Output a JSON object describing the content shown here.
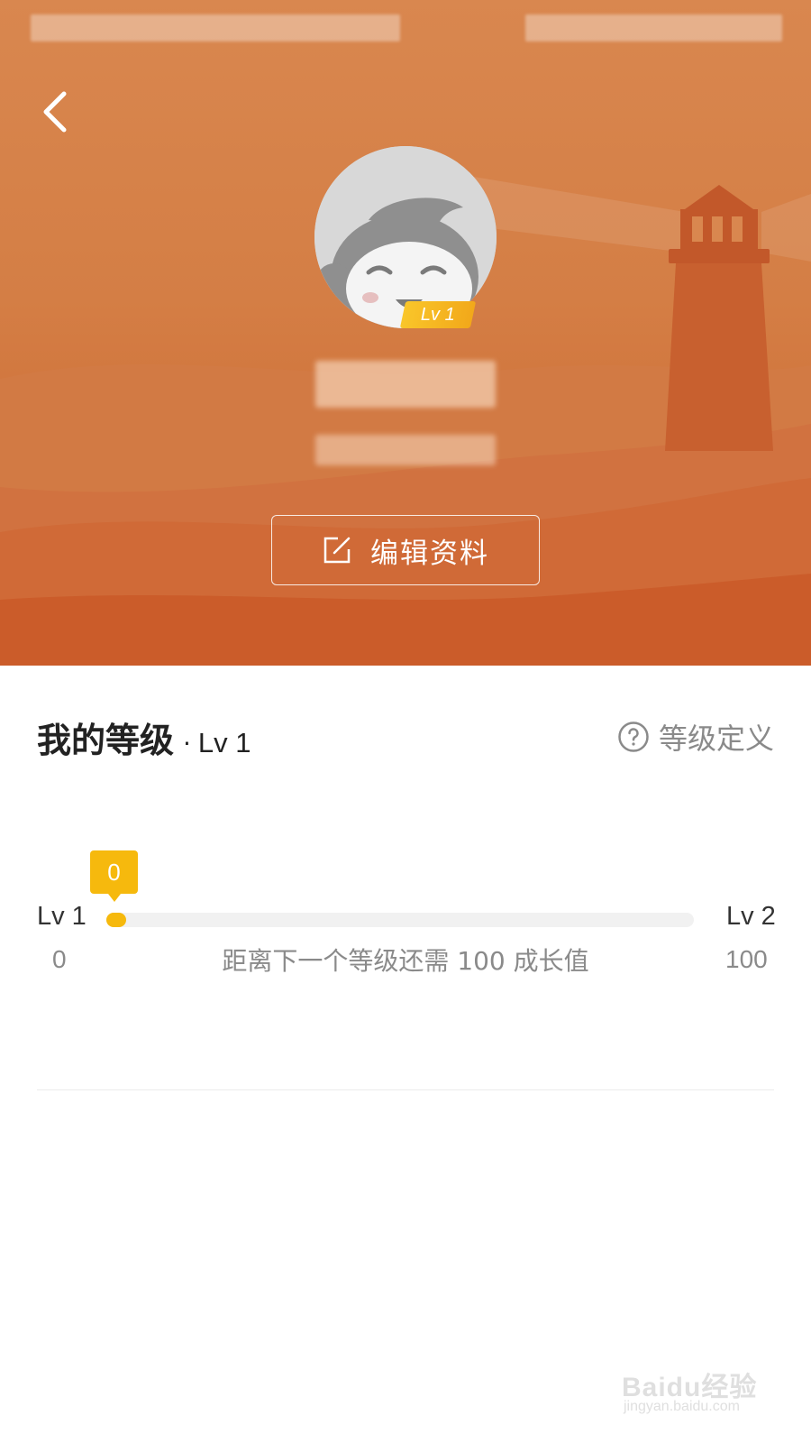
{
  "header": {
    "back_icon": "chevron-left-icon",
    "avatar_level_badge": "Lv 1",
    "edit_button_label": "编辑资料",
    "edit_icon": "edit-icon",
    "colors": {
      "hero_top": "#d9874f",
      "hero_bottom": "#c9612c",
      "lighthouse": "#c2582a"
    }
  },
  "level": {
    "title": "我的等级",
    "separator": "·",
    "current_level": "Lv 1",
    "definition_link": "等级定义",
    "definition_icon": "help-circle-icon",
    "progress": {
      "tooltip_value": "0",
      "start_level": "Lv 1",
      "end_level": "Lv 2",
      "start_value": "0",
      "end_value": "100",
      "current": 0,
      "max": 100,
      "note": "距离下一个等级还需 100 成长值",
      "accent_color": "#f6b90d"
    }
  },
  "watermark": {
    "text": "Baidu经验",
    "sub": "jingyan.baidu.com"
  }
}
